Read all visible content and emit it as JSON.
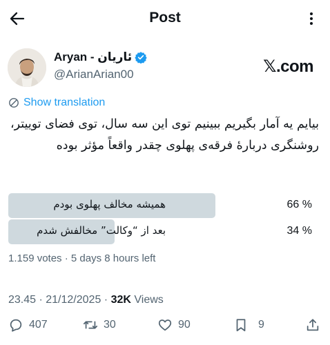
{
  "header": {
    "title": "Post"
  },
  "author": {
    "name": "Aryan - ئاریان",
    "handle": "@ArianArian00"
  },
  "watermark": "𝕏.com",
  "translate_label": "Show translation",
  "tweet_text": "بیایم یه آمار بگیریم ببینیم توی این سه سال، توی فضای توییتر، روشنگری دربارهٔ فرقه‌ی پهلوی چقدر واقعاً مؤثر بوده",
  "poll": {
    "options": [
      {
        "label": "همیشه مخالف پهلوی بودم",
        "percent_label": "66 %",
        "percent": 66
      },
      {
        "label": "بعد از “وکالت” مخالفش شدم",
        "percent_label": "34 %",
        "percent": 34
      }
    ],
    "meta": "1.159 votes · 5 days 8 hours left"
  },
  "timestamp": {
    "datetime": "23.45 · 21/12/2025 · ",
    "views_count": "32K",
    "views_label": "Views"
  },
  "actions": {
    "replies": "407",
    "reposts": "30",
    "likes": "90",
    "bookmarks": "9"
  },
  "colors": {
    "link": "#1d9bf0",
    "muted": "#536471",
    "poll_bar": "#cfd9de",
    "verified": "#1d9bf0"
  },
  "icons": [
    "back-arrow-icon",
    "more-icon",
    "verified-badge-icon",
    "translate-icon",
    "reply-icon",
    "repost-icon",
    "like-icon",
    "bookmark-icon",
    "share-icon"
  ]
}
